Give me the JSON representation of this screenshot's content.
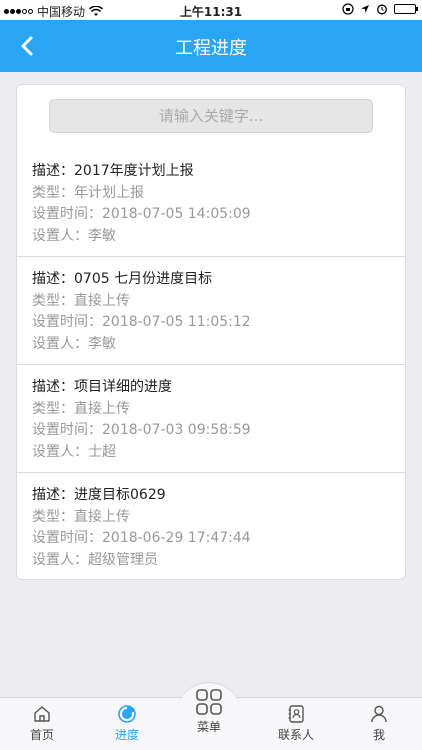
{
  "status_bar": {
    "carrier": "中国移动",
    "time": "上午11:31"
  },
  "header": {
    "title": "工程进度"
  },
  "search": {
    "placeholder": "请输入关键字..."
  },
  "progress_items": [
    {
      "desc_label": "描述：",
      "desc": "2017年度计划上报",
      "type_label": "类型：",
      "type": "年计划上报",
      "time_label": "设置时间：",
      "time": "2018-07-05 14:05:09",
      "setter_label": "设置人：",
      "setter": "李敏"
    },
    {
      "desc_label": "描述：",
      "desc": "0705 七月份进度目标",
      "type_label": "类型：",
      "type": "直接上传",
      "time_label": "设置时间：",
      "time": "2018-07-05 11:05:12",
      "setter_label": "设置人：",
      "setter": "李敏"
    },
    {
      "desc_label": "描述：",
      "desc": "项目详细的进度",
      "type_label": "类型：",
      "type": "直接上传",
      "time_label": "设置时间：",
      "time": "2018-07-03 09:58:59",
      "setter_label": "设置人：",
      "setter": "士超"
    },
    {
      "desc_label": "描述：",
      "desc": "进度目标0629",
      "type_label": "类型：",
      "type": "直接上传",
      "time_label": "设置时间：",
      "time": "2018-06-29 17:47:44",
      "setter_label": "设置人：",
      "setter": "超级管理员"
    }
  ],
  "tab_bar": {
    "items": [
      {
        "label": "首页",
        "icon": "home-icon"
      },
      {
        "label": "进度",
        "icon": "progress-icon",
        "active": true
      },
      {
        "label": "菜单",
        "icon": "menu-grid-icon"
      },
      {
        "label": "联系人",
        "icon": "contacts-icon"
      },
      {
        "label": "我",
        "icon": "user-icon"
      }
    ]
  },
  "colors": {
    "primary": "#2aa5f4",
    "background": "#ececf1"
  }
}
